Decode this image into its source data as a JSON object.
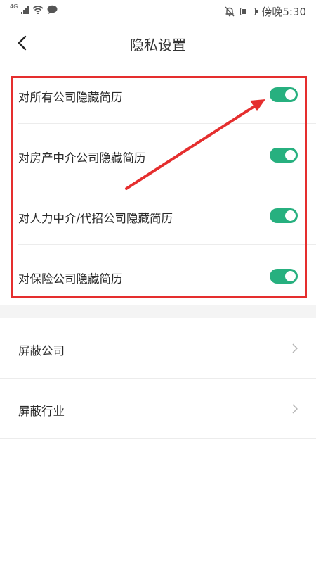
{
  "status_bar": {
    "network": "4G",
    "time": "傍晚5:30",
    "battery_level": 0.45
  },
  "header": {
    "title": "隐私设置",
    "back_icon": "back-arrow-icon"
  },
  "privacy_toggles": [
    {
      "label": "对所有公司隐藏简历",
      "on": true
    },
    {
      "label": "对房产中介公司隐藏简历",
      "on": true
    },
    {
      "label": "对人力中介/代招公司隐藏简历",
      "on": true
    },
    {
      "label": "对保险公司隐藏简历",
      "on": true
    }
  ],
  "block_items": [
    {
      "label": "屏蔽公司",
      "icon": "chevron-right-icon"
    },
    {
      "label": "屏蔽行业",
      "icon": "chevron-right-icon"
    }
  ],
  "colors": {
    "toggle_on": "#27b07f",
    "highlight": "#e52e2e"
  }
}
